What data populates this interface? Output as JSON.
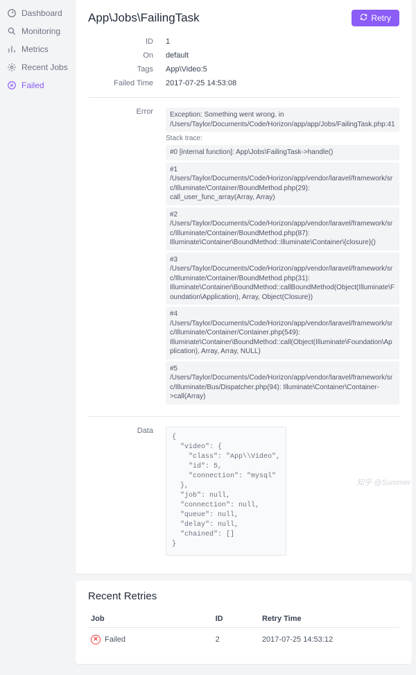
{
  "sidebar": {
    "items": [
      {
        "label": "Dashboard",
        "icon": "gauge-icon"
      },
      {
        "label": "Monitoring",
        "icon": "search-icon"
      },
      {
        "label": "Metrics",
        "icon": "bars-icon"
      },
      {
        "label": "Recent Jobs",
        "icon": "gear-icon"
      },
      {
        "label": "Failed",
        "icon": "circle-x-icon"
      }
    ]
  },
  "header": {
    "title": "App\\Jobs\\FailingTask",
    "retry_label": "Retry"
  },
  "details": {
    "id_label": "ID",
    "id_value": "1",
    "on_label": "On",
    "on_value": "default",
    "tags_label": "Tags",
    "tags_value": "App\\Video:5",
    "failed_label": "Failed Time",
    "failed_value": "2017-07-25 14:53:08"
  },
  "error": {
    "label": "Error",
    "exception": "Exception: Something went wrong. in /Users/Taylor/Documents/Code/Horizon/app/app/Jobs/FailingTask.php:41",
    "stack_label": "Stack trace:",
    "frames": [
      "#0 [internal function]: App\\Jobs\\FailingTask->handle()",
      "#1 /Users/Taylor/Documents/Code/Horizon/app/vendor/laravel/framework/src/Illuminate/Container/BoundMethod.php(29): call_user_func_array(Array, Array)",
      "#2 /Users/Taylor/Documents/Code/Horizon/app/vendor/laravel/framework/src/Illuminate/Container/BoundMethod.php(87): Illuminate\\Container\\BoundMethod::Illuminate\\Container\\{closure}()",
      "#3 /Users/Taylor/Documents/Code/Horizon/app/vendor/laravel/framework/src/Illuminate/Container/BoundMethod.php(31): Illuminate\\Container\\BoundMethod::callBoundMethod(Object(Illuminate\\Foundation\\Application), Array, Object(Closure))",
      "#4 /Users/Taylor/Documents/Code/Horizon/app/vendor/laravel/framework/src/Illuminate/Container/Container.php(549): Illuminate\\Container\\BoundMethod::call(Object(Illuminate\\Foundation\\Application), Array, Array, NULL)",
      "#5 /Users/Taylor/Documents/Code/Horizon/app/vendor/laravel/framework/src/Illuminate/Bus/Dispatcher.php(94): Illuminate\\Container\\Container->call(Array)"
    ]
  },
  "data": {
    "label": "Data",
    "json": "{\n  \"video\": {\n    \"class\": \"App\\\\Video\",\n    \"id\": 5,\n    \"connection\": \"mysql\"\n  },\n  \"job\": null,\n  \"connection\": null,\n  \"queue\": null,\n  \"delay\": null,\n  \"chained\": []\n}"
  },
  "retries": {
    "title": "Recent Retries",
    "cols": {
      "job": "Job",
      "id": "ID",
      "time": "Retry Time"
    },
    "rows": [
      {
        "status": "Failed",
        "id": "2",
        "time": "2017-07-25 14:53:12"
      }
    ]
  },
  "watermark": "知乎 @Summer"
}
